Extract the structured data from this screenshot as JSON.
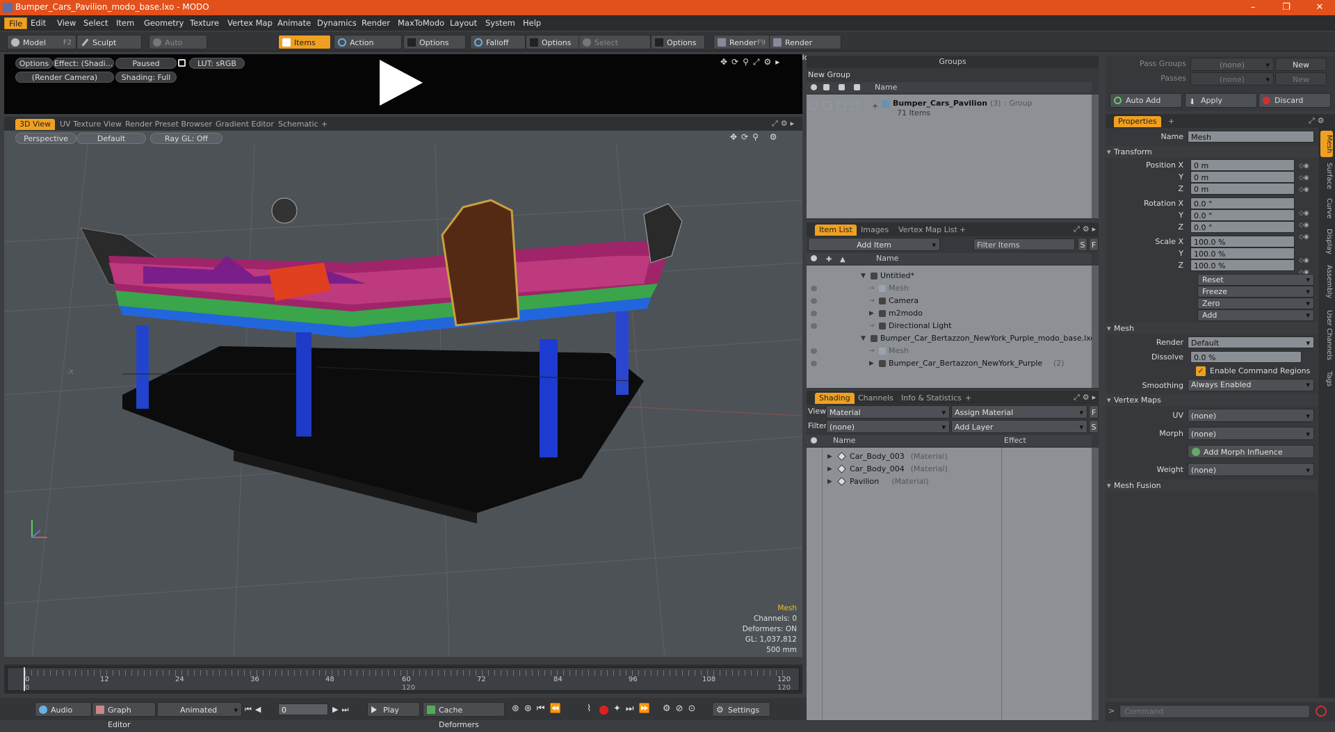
{
  "window": {
    "title": "Bumper_Cars_Pavilion_modo_base.lxo - MODO",
    "min": "–",
    "max": "❐",
    "close": "✕"
  },
  "menu": [
    "File",
    "Edit",
    "View",
    "Select",
    "Item",
    "Geometry",
    "Texture",
    "Vertex Map",
    "Animate",
    "Dynamics",
    "Render",
    "MaxToModo",
    "Layout",
    "System",
    "Help"
  ],
  "toolbar": {
    "model": "Model",
    "model_key": "F2",
    "sculpt": "Sculpt",
    "auto_select": "Auto Select",
    "items": "Items",
    "action_center": "Action Center",
    "options1": "Options",
    "falloff": "Falloff",
    "options2": "Options",
    "select_through": "Select Through",
    "options3": "Options",
    "render": "Render",
    "render_key": "F9",
    "render_window": "Render Window"
  },
  "preview": {
    "options": "Options",
    "effect": "Effect: (Shadi...",
    "paused": "Paused",
    "lut": "LUT: sRGB",
    "camera": "(Render Camera)",
    "shading": "Shading: Full"
  },
  "viewtabs": [
    "3D View",
    "UV Texture View",
    "Render Preset Browser",
    "Gradient Editor",
    "Schematic",
    "+"
  ],
  "viewport": {
    "perspective": "Perspective",
    "default": "Default",
    "raygl": "Ray GL: Off",
    "axis_label": "-X",
    "hud": {
      "mesh": "Mesh",
      "channels": "Channels: 0",
      "deformers": "Deformers: ON",
      "gl": "GL: 1,037,812",
      "units": "500 mm"
    }
  },
  "timeline": {
    "ticks": [
      "0",
      "12",
      "24",
      "36",
      "48",
      "60",
      "72",
      "84",
      "96",
      "108",
      "120"
    ],
    "bottom_ticks": [
      "0",
      "120",
      "120"
    ]
  },
  "transport": {
    "audio": "Audio",
    "graph_editor": "Graph Editor",
    "animated": "Animated",
    "frame": "0",
    "play": "Play",
    "cache": "Cache Deformers",
    "settings": "Settings"
  },
  "groups": {
    "title": "Groups",
    "new_group": "New Group",
    "col_name": "Name",
    "item_name": "Bumper_Cars_Pavilion",
    "item_count": "(3)",
    "item_type": ": Group",
    "item_sub": "71 Items"
  },
  "itemlist": {
    "tabs": [
      "Item List",
      "Images",
      "Vertex Map List",
      "+"
    ],
    "add_item": "Add Item",
    "filter": "Filter Items",
    "s": "S",
    "f": "F",
    "col_name": "Name",
    "rows": [
      {
        "label": "Untitled*",
        "indent": 0,
        "arrow": "▼",
        "gray": false,
        "eye": false
      },
      {
        "label": "Mesh",
        "indent": 1,
        "arrow": "",
        "gray": true,
        "eye": true
      },
      {
        "label": "Camera",
        "indent": 1,
        "arrow": "",
        "gray": false,
        "eye": true
      },
      {
        "label": "m2modo",
        "indent": 1,
        "arrow": "▶",
        "gray": false,
        "eye": true
      },
      {
        "label": "Directional Light",
        "indent": 1,
        "arrow": "",
        "gray": false,
        "eye": true
      },
      {
        "label": "Bumper_Car_Bertazzon_NewYork_Purple_modo_base.lxo*",
        "indent": 0,
        "arrow": "▼",
        "gray": false,
        "eye": false
      },
      {
        "label": "Mesh",
        "indent": 1,
        "arrow": "",
        "gray": true,
        "eye": true
      },
      {
        "label": "Bumper_Car_Bertazzon_NewYork_Purple",
        "indent": 1,
        "arrow": "▶",
        "gray": false,
        "eye": true,
        "count": "(2)"
      }
    ]
  },
  "shading": {
    "tabs": [
      "Shading",
      "Channels",
      "Info & Statistics",
      "+"
    ],
    "view_label": "View",
    "view_value": "Material",
    "assign": "Assign Material",
    "filter_label": "Filter",
    "filter_value": "(none)",
    "add_layer": "Add Layer",
    "f": "F",
    "s": "S",
    "col_name": "Name",
    "col_effect": "Effect",
    "rows": [
      {
        "name": "Car_Body_003",
        "type": "(Material)"
      },
      {
        "name": "Car_Body_004",
        "type": "(Material)"
      },
      {
        "name": "Pavilion",
        "type": "(Material)"
      }
    ]
  },
  "passes": {
    "pass_groups": "Pass Groups",
    "pass_value": "(none)",
    "new1": "New",
    "passes": "Passes",
    "passes_value": "(none)",
    "new2": "New",
    "auto_add": "Auto Add",
    "apply": "Apply",
    "discard": "Discard"
  },
  "properties": {
    "tab": "Properties",
    "name_label": "Name",
    "name_value": "Mesh",
    "transform": "Transform",
    "position_label": "Position X",
    "pos": [
      "0 m",
      "0 m",
      "0 m"
    ],
    "rotation_label": "Rotation X",
    "rot": [
      "0.0 °",
      "0.0 °",
      "0.0 °"
    ],
    "scale_label": "Scale X",
    "scale": [
      "100.0 %",
      "100.0 %",
      "100.0 %"
    ],
    "y": "Y",
    "z": "Z",
    "reset": "Reset",
    "freeze": "Freeze",
    "zero": "Zero",
    "add": "Add",
    "mesh": "Mesh",
    "render_label": "Render",
    "render_value": "Default",
    "dissolve_label": "Dissolve",
    "dissolve_value": "0.0 %",
    "enable_cmd": "Enable Command Regions",
    "smoothing_label": "Smoothing",
    "smoothing_value": "Always Enabled",
    "vertex_maps": "Vertex Maps",
    "uv_label": "UV",
    "uv_value": "(none)",
    "morph_label": "Morph",
    "morph_value": "(none)",
    "add_morph": "Add Morph Influence",
    "weight_label": "Weight",
    "weight_value": "(none)",
    "mesh_fusion": "Mesh Fusion",
    "side_tabs": [
      "Mesh",
      "Surface",
      "Curve",
      "Display",
      "Assembly",
      "User Channels",
      "Tags"
    ]
  },
  "command": {
    "placeholder": "Command"
  }
}
